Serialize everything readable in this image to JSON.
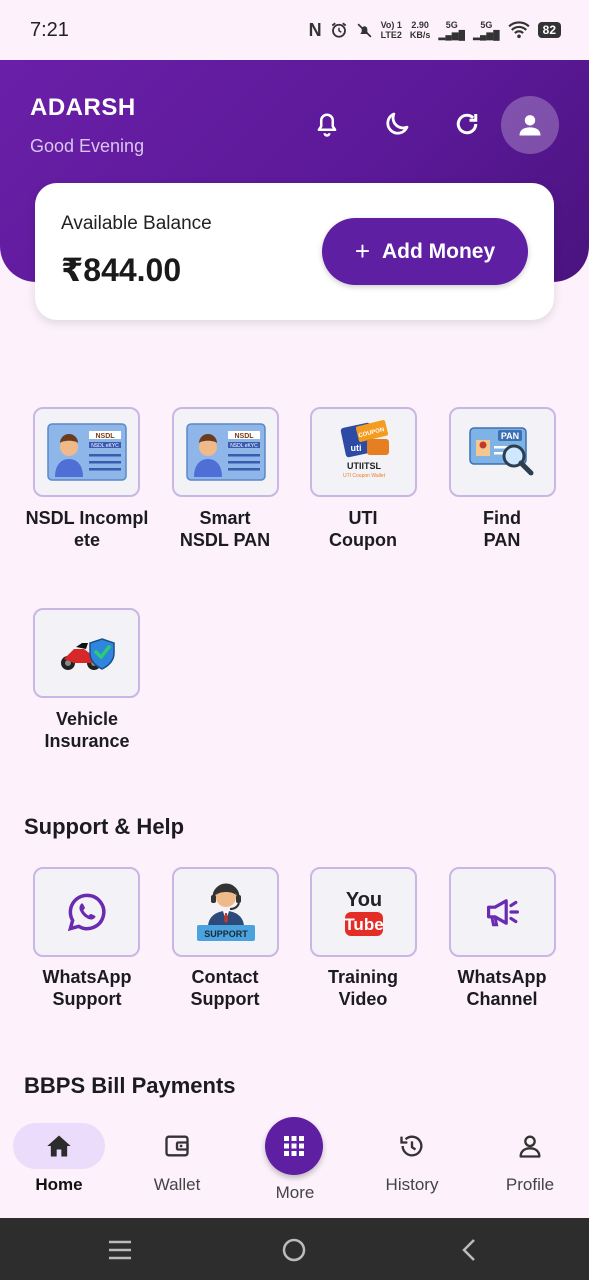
{
  "status_bar": {
    "time": "7:21",
    "network_1": "Vo) 1",
    "network_2": "LTE2",
    "speed": "2.90",
    "speed_unit": "KB/s",
    "sig_1": "5G",
    "sig_2": "5G",
    "battery": "82"
  },
  "header": {
    "user_name": "ADARSH",
    "greeting": "Good Evening"
  },
  "balance": {
    "label": "Available Balance",
    "amount": "₹844.00",
    "add_money_label": "Add Money"
  },
  "services": [
    {
      "line1": "NSDL Incompl",
      "line2": "ete"
    },
    {
      "line1": "Smart",
      "line2": "NSDL PAN"
    },
    {
      "line1": "UTI",
      "line2": "Coupon"
    },
    {
      "line1": "Find",
      "line2": "PAN"
    },
    {
      "line1": "Vehicle",
      "line2": "Insurance"
    }
  ],
  "tile_art": {
    "nsdl": "NSDL",
    "nsdl_ekyc": "NSDL eKYC",
    "uti": "uti",
    "utiitsl": "UTIITSL",
    "uti_wallet": "UTI Coupon Wallet",
    "coupon": "COUPON",
    "pan": "PAN"
  },
  "support": {
    "title": "Support & Help",
    "items": [
      {
        "line1": "WhatsApp",
        "line2": "Support"
      },
      {
        "line1": "Contact",
        "line2": "Support"
      },
      {
        "line1": "Training",
        "line2": "Video"
      },
      {
        "line1": "WhatsApp",
        "line2": "Channel"
      }
    ],
    "support_badge": "SUPPORT",
    "youtube_you": "You",
    "youtube_tube": "Tube"
  },
  "bbps": {
    "title": "BBPS Bill Payments"
  },
  "bottom_nav": {
    "home": "Home",
    "wallet": "Wallet",
    "more": "More",
    "history": "History",
    "profile": "Profile"
  },
  "colors": {
    "primary": "#5e1fa3",
    "header_bg": "#6a1fa8",
    "page_bg": "#fdf2fb",
    "tile_border": "#c9b6e4",
    "nav_active_pill": "#ecdcfb"
  }
}
